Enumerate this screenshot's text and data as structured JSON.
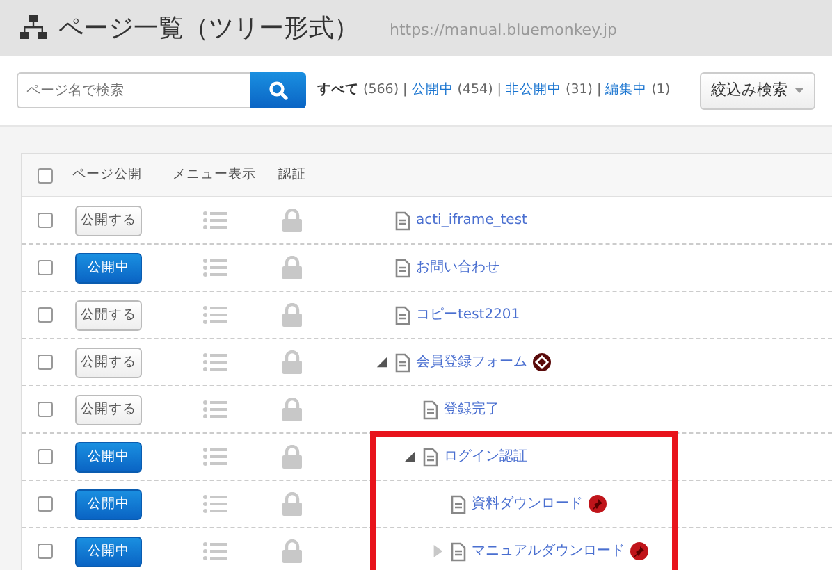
{
  "header": {
    "title": "ページ一覧（ツリー形式）",
    "url": "https://manual.bluemonkey.jp"
  },
  "search": {
    "placeholder": "ページ名で検索"
  },
  "filters": [
    {
      "label": "すべて",
      "count": "(566)",
      "selected": true
    },
    {
      "separator": "|",
      "label": "公開中",
      "count": "(454)",
      "selected": false
    },
    {
      "separator": "|",
      "label": "非公開中",
      "count": "(31)",
      "selected": false
    },
    {
      "separator": "|",
      "label": "編集中",
      "count": "(1)",
      "selected": false
    }
  ],
  "filter_button": "絞込み検索",
  "table": {
    "columns": [
      "ページ公開",
      "メニュー表示",
      "認証"
    ],
    "select_all_checked": false,
    "tree": [
      {
        "title": "acti_iframe_test",
        "checked": false,
        "published": false,
        "publish_label": "公開する",
        "highlighted": false
      },
      {
        "title": "お問い合わせ",
        "checked": false,
        "published": true,
        "publish_label": "公開中",
        "highlighted": false
      },
      {
        "title": "コピーtest2201",
        "checked": false,
        "published": false,
        "publish_label": "公開する",
        "highlighted": false
      },
      {
        "title": "会員登録フォーム",
        "checked": false,
        "published": false,
        "publish_label": "公開する",
        "highlighted": false,
        "form_icon": true,
        "expanded": true,
        "children": [
          {
            "title": "登録完了",
            "checked": false,
            "published": false,
            "publish_label": "公開する",
            "highlighted": false
          },
          {
            "title": "ログイン認証",
            "checked": false,
            "published": true,
            "publish_label": "公開中",
            "highlighted": true,
            "expanded": true,
            "children": [
              {
                "title": "資料ダウンロード",
                "checked": false,
                "published": true,
                "publish_label": "公開中",
                "highlighted": true,
                "pin_icon": true
              },
              {
                "title": "マニュアルダウンロード",
                "checked": false,
                "published": true,
                "publish_label": "公開中",
                "highlighted": true,
                "pin_icon": true,
                "expanded": false
              }
            ]
          }
        ]
      }
    ]
  }
}
